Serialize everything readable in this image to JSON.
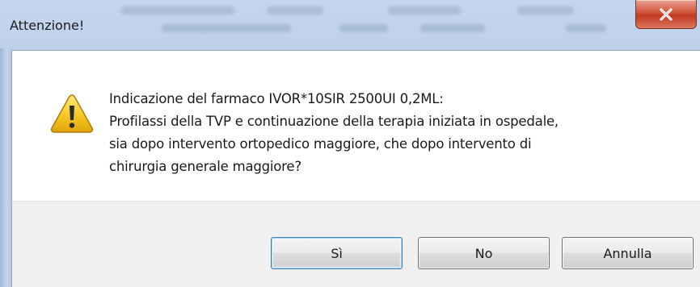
{
  "window": {
    "title": "Attenzione!"
  },
  "icons": {
    "warning": "warning-icon",
    "close": "close-icon"
  },
  "message": {
    "lines": [
      "Indicazione del farmaco IVOR*10SIR 2500UI 0,2ML:",
      "Profilassi della TVP e continuazione della terapia iniziata in ospedale,",
      "sia dopo intervento ortopedico maggiore, che dopo intervento di",
      "chirurgia generale maggiore?"
    ]
  },
  "buttons": {
    "yes": "Sì",
    "no": "No",
    "cancel": "Annulla"
  },
  "colors": {
    "close_button": "#c9462b",
    "default_button_border": "#3c7fb1",
    "warning_fill": "#f5c520"
  }
}
